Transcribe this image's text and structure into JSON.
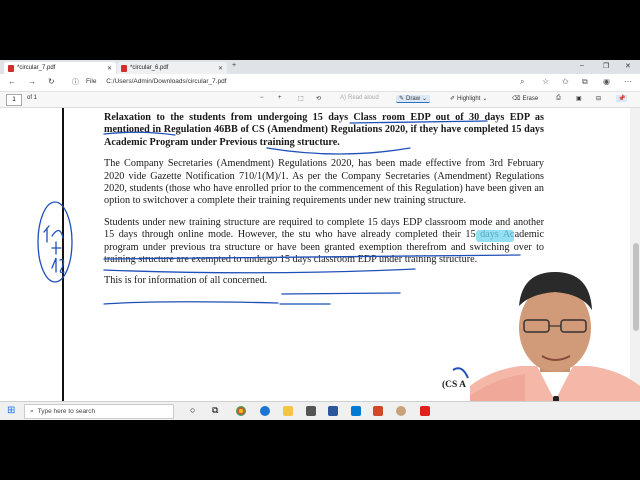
{
  "tabs": [
    {
      "label": "*circular_7.pdf",
      "active": true
    },
    {
      "label": "*circular_6.pdf",
      "active": false
    }
  ],
  "address": {
    "file_label": "File",
    "path": "C:/Users/Admin/Downloads/circular_7.pdf"
  },
  "pdf_toolbar": {
    "page_number": "1",
    "page_of": "of 1",
    "read_aloud": "Read aloud",
    "draw": "Draw",
    "highlight": "Highlight",
    "erase": "Erase"
  },
  "document": {
    "para1": "Relaxation to the students from undergoing 15 days Class room EDP out of 30 days EDP as mentioned in Regulation 46BB of CS (Amendment) Regulations 2020, if they have completed 15 days Academic Program under Previous training structure.",
    "para2": "The Company Secretaries (Amendment) Regulations 2020, has been made effective from 3rd February 2020 vide Gazette Notification 710/1(M)/1. As per the Company Secretaries (Amendment) Regulations 2020, students (those who have enrolled prior to the commencement of this Regulation) have been given an option to switchover a complete their training requirements under new training structure.",
    "para3": "Students under new training structure are required to complete 15 days EDP classroom mode and another 15 days through online mode. However, the stu who have already completed their 15 days Academic program under previous tra structure or have been granted exemption therefrom and switching over to training structure are exempted to undergo 15 days classroom EDP under training structure.",
    "para4": "This is for information of all concerned.",
    "signature_fragment": "(CS A",
    "margin_note": "15+15"
  },
  "taskbar": {
    "search_placeholder": "Type here to search"
  },
  "colors": {
    "ink_blue": "#1f4fb8",
    "tab_bg": "#dfe3e8",
    "highlight_cyan": "#6fd6ef"
  }
}
